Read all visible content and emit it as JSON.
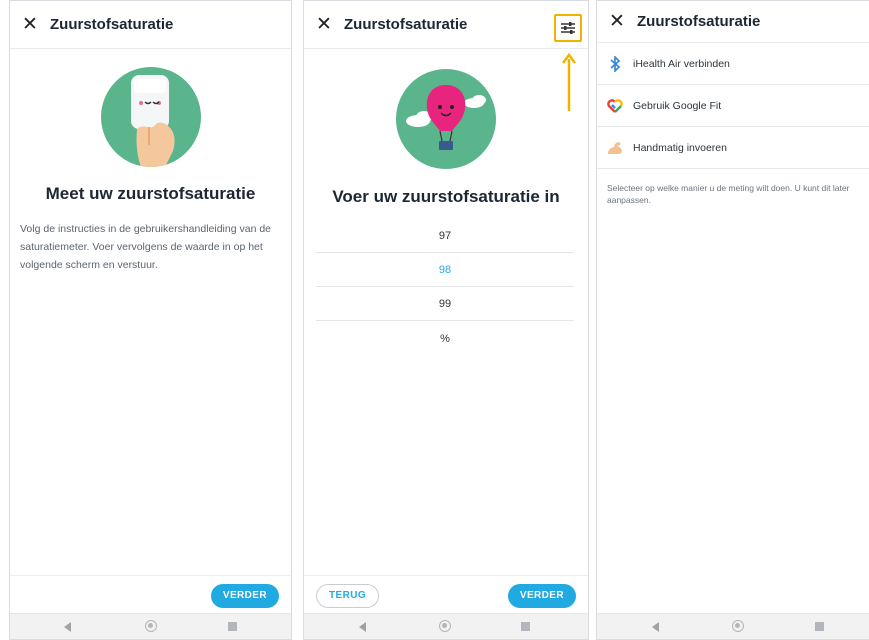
{
  "screen1": {
    "close_icon": "close-icon",
    "title": "Zuurstofsaturatie",
    "heading": "Meet uw zuurstofsaturatie",
    "body": "Volg de instructies in de gebruikershandleiding van de saturatiemeter. Voer vervolgens de waarde in op het volgende scherm en verstuur.",
    "next_label": "VERDER"
  },
  "screen2": {
    "close_icon": "close-icon",
    "title": "Zuurstofsaturatie",
    "filter_icon": "filter-sliders-icon",
    "heading": "Voer uw zuurstofsaturatie in",
    "picker": {
      "above": "97",
      "selected": "98",
      "below": "99"
    },
    "unit": "%",
    "back_label": "TERUG",
    "next_label": "VERDER"
  },
  "screen3": {
    "close_icon": "close-icon",
    "title": "Zuurstofsaturatie",
    "options": [
      {
        "label": "iHealth Air verbinden",
        "icon": "bluetooth-icon"
      },
      {
        "label": "Gebruik Google Fit",
        "icon": "google-fit-icon"
      },
      {
        "label": "Handmatig invoeren",
        "icon": "flexed-arm-icon"
      }
    ],
    "hint": "Selecteer op welke manier u de meting wilt doen. U kunt dit later aanpassen."
  },
  "colors": {
    "accent": "#21a9e1",
    "illustration_bg": "#5ab48c",
    "highlight": "#f0b400",
    "balloon": "#e8247f"
  }
}
